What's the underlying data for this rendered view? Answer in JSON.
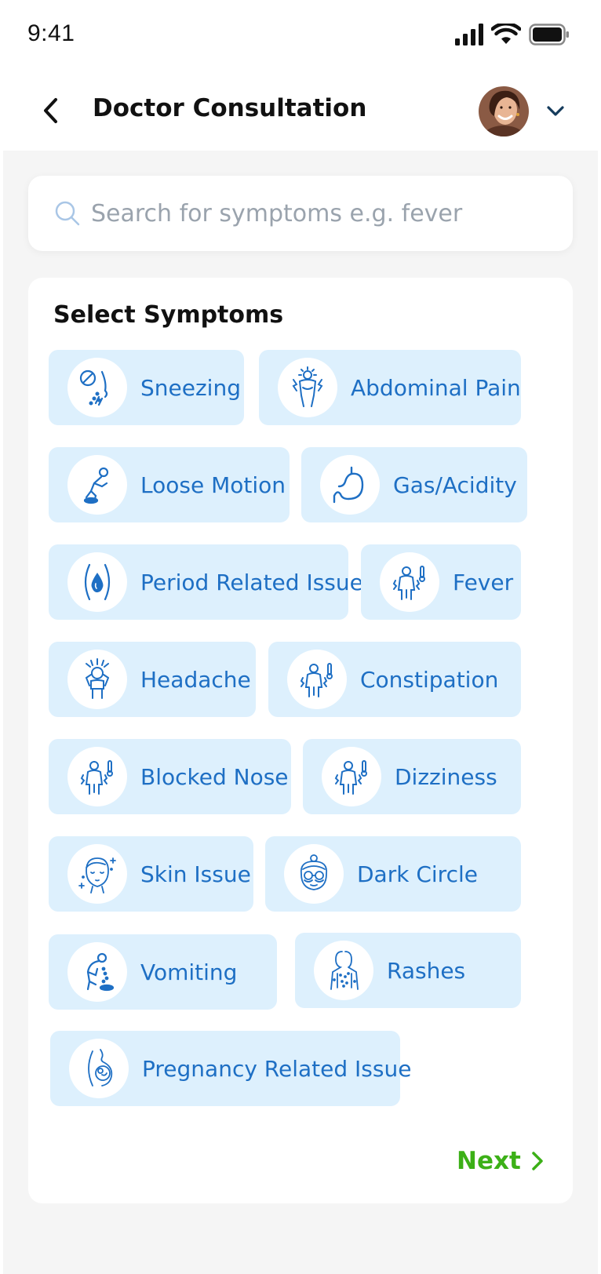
{
  "status_bar": {
    "time": "9:41"
  },
  "header": {
    "title": "Doctor Consultation"
  },
  "search": {
    "placeholder": "Search for symptoms e.g. fever"
  },
  "symptoms_card": {
    "title": "Select Symptoms",
    "chips": [
      {
        "label": "Sneezing",
        "icon": "sneezing-icon"
      },
      {
        "label": "Abdominal Pain",
        "icon": "abdominal-pain-icon"
      },
      {
        "label": "Loose Motion",
        "icon": "loose-motion-icon"
      },
      {
        "label": "Gas/Acidity",
        "icon": "stomach-icon"
      },
      {
        "label": "Period Related Issue",
        "icon": "uterus-drop-icon"
      },
      {
        "label": "Fever",
        "icon": "fever-icon"
      },
      {
        "label": "Headache",
        "icon": "headache-icon"
      },
      {
        "label": "Constipation",
        "icon": "constipation-icon"
      },
      {
        "label": "Blocked Nose",
        "icon": "blocked-nose-icon"
      },
      {
        "label": "Dizziness",
        "icon": "dizziness-icon"
      },
      {
        "label": "Skin Issue",
        "icon": "skin-face-icon"
      },
      {
        "label": "Dark Circle",
        "icon": "dark-circle-face-icon"
      },
      {
        "label": "Vomiting",
        "icon": "vomiting-icon"
      },
      {
        "label": "Rashes",
        "icon": "rashes-icon"
      },
      {
        "label": "Pregnancy Related Issue",
        "icon": "pregnancy-icon"
      }
    ],
    "next_label": "Next"
  },
  "colors": {
    "chip_background": "#ddf0fd",
    "chip_text": "#1e6fc4",
    "next_green": "#3cb017",
    "page_background": "#f5f5f5"
  }
}
